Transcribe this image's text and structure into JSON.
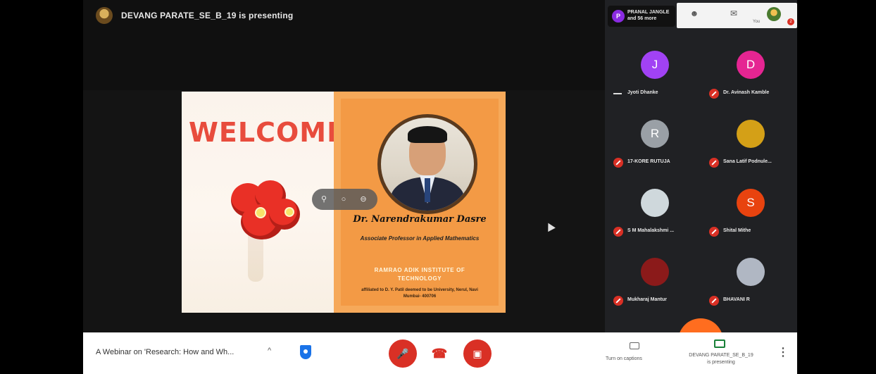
{
  "presenter_banner": {
    "text": "DEVANG PARATE_SE_B_19 is presenting"
  },
  "slide": {
    "welcome": "WELCOME",
    "speaker_name": "Dr. Narendrakumar Dasre",
    "speaker_role": "Associate Professor in Applied Mathematics",
    "institute": "RAMRAO ADIK INSTITUTE OF TECHNOLOGY",
    "affiliation": "affiliated to D. Y. Patil deemed to be University, Nerul, Navi Mumbai- 400706"
  },
  "participants_header": {
    "more_avatar_letter": "P",
    "more_text_line1": "PRANAL JANGLE",
    "more_text_line2": "and 56 more",
    "icon_names": [
      "people-icon",
      "chat-icon"
    ],
    "you_label": "You",
    "you_badge": "2"
  },
  "tiles": [
    {
      "name": "Jyoti Dhanke",
      "avatar": "J",
      "color": "#a142f4",
      "muted": false
    },
    {
      "name": "Dr. Avinash Kamble",
      "avatar": "D",
      "color": "#e52592",
      "muted": true
    },
    {
      "name": "17-KORE RUTUJA",
      "avatar": "R",
      "color": "#9aa0a6",
      "muted": true
    },
    {
      "name": "Sana Latif Podnule...",
      "avatar": "",
      "color": "#d4a017",
      "muted": true
    },
    {
      "name": "S M Mahalakshmi ...",
      "avatar": "",
      "color": "#cfd8dc",
      "muted": true
    },
    {
      "name": "Shital Mithe",
      "avatar": "S",
      "color": "#e8430f",
      "muted": true
    },
    {
      "name": "Mukharaj Mantur",
      "avatar": "",
      "color": "#8b1a1a",
      "muted": true
    },
    {
      "name": "BHAVANI R",
      "avatar": "",
      "color": "#b0b7c3",
      "muted": true
    }
  ],
  "bottom_bar": {
    "meeting_title": "A Webinar on 'Research: How and Wh...",
    "captions_label": "Turn on captions",
    "presenting_line1": "DEVANG PARATE_SE_B_19",
    "presenting_line2": "is presenting"
  },
  "colors": {
    "accent_red": "#d93025",
    "slide_orange": "#f39a45",
    "welcome_red": "#e84c3d"
  }
}
